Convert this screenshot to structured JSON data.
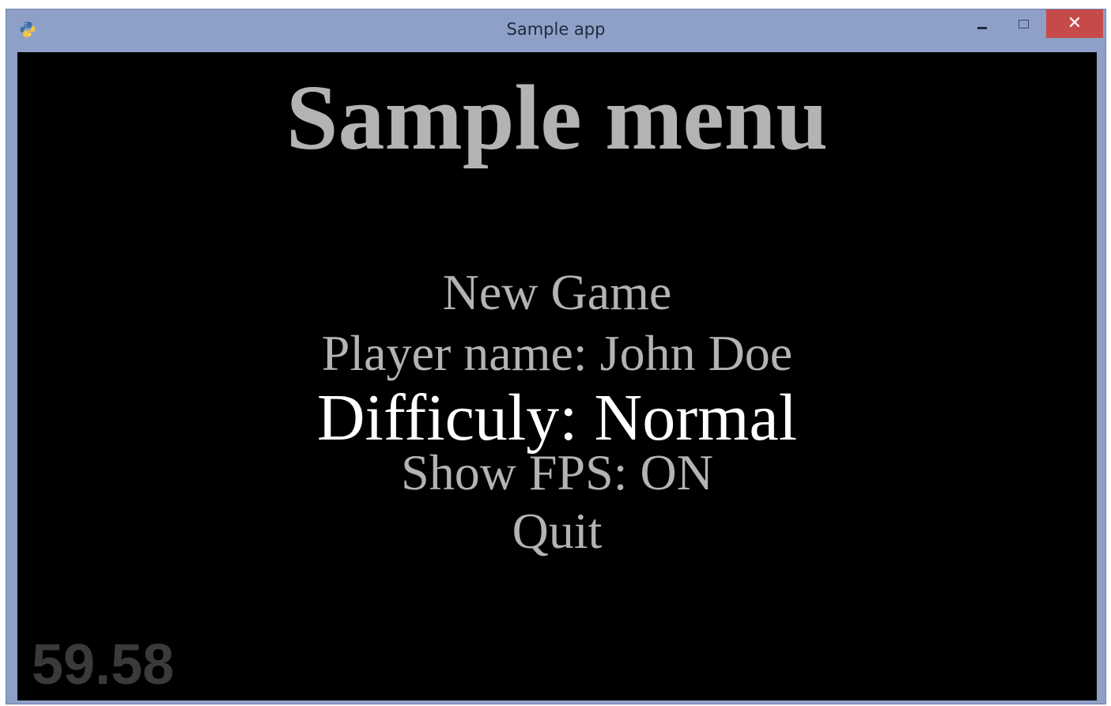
{
  "window": {
    "title": "Sample app",
    "app_icon": "python-icon",
    "controls": {
      "minimize_icon": "minimize-icon",
      "maximize_icon": "maximize-icon",
      "close_icon": "close-icon",
      "close_glyph": "✕"
    }
  },
  "menu": {
    "title": "Sample menu",
    "items": [
      {
        "label": "New Game",
        "selected": false
      },
      {
        "label": "Player name: John Doe",
        "selected": false
      },
      {
        "label": "Difficuly: Normal",
        "selected": true
      },
      {
        "label": "Show FPS: ON",
        "selected": false
      },
      {
        "label": "Quit",
        "selected": false
      }
    ]
  },
  "fps_counter": "59.58",
  "colors": {
    "titlebar": "#8fa0c8",
    "close_button": "#c74a4a",
    "background": "#000000",
    "menu_text": "#b3b3b3",
    "menu_selected": "#ffffff",
    "fps_text": "#3a3a3a"
  }
}
